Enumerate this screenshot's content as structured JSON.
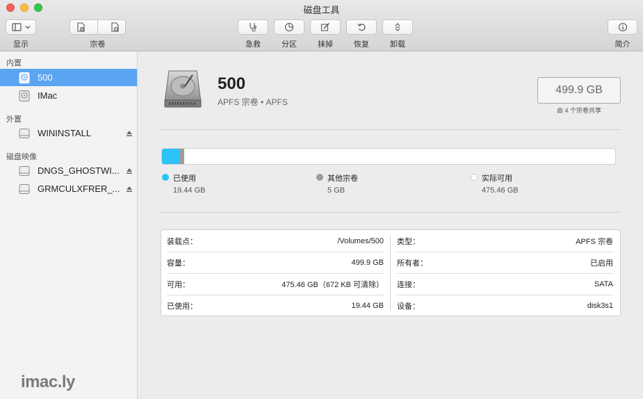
{
  "window": {
    "title": "磁盘工具"
  },
  "toolbar": {
    "display_label": "显示",
    "volume_label": "宗卷",
    "firstaid_label": "急救",
    "partition_label": "分区",
    "erase_label": "抹掉",
    "restore_label": "恢复",
    "unmount_label": "卸载",
    "info_label": "简介"
  },
  "sidebar": {
    "sections": [
      {
        "title": "内置",
        "items": [
          {
            "label": "500"
          },
          {
            "label": "IMac"
          }
        ]
      },
      {
        "title": "外置",
        "items": [
          {
            "label": "WININSTALL"
          }
        ]
      },
      {
        "title": "磁盘映像",
        "items": [
          {
            "label": "DNGS_GHOSTWI..."
          },
          {
            "label": "GRMCULXFRER_..."
          }
        ]
      }
    ],
    "watermark": "imac.ly"
  },
  "disk": {
    "name": "500",
    "subtitle": "APFS 宗卷 • APFS",
    "capacity": "499.9 GB",
    "capacity_note": "由 4 个宗卷共享"
  },
  "usage": {
    "total_gb": 499.9,
    "used_gb": 19.44,
    "other_gb": 5,
    "free_gb": 475.46,
    "used_color": "#2ec3f6",
    "other_color": "#9c9c9c",
    "free_color": "#ffffff",
    "legend": [
      {
        "label": "已使用",
        "value": "19.44 GB"
      },
      {
        "label": "其他宗卷",
        "value": "5 GB"
      },
      {
        "label": "实际可用",
        "value": "475.46 GB"
      }
    ]
  },
  "info": {
    "left": [
      {
        "key": "装载点：",
        "value": "/Volumes/500"
      },
      {
        "key": "容量：",
        "value": "499.9 GB"
      },
      {
        "key": "可用：",
        "value": "475.46 GB（672 KB 可清除）"
      },
      {
        "key": "已使用：",
        "value": "19.44 GB"
      }
    ],
    "right": [
      {
        "key": "类型：",
        "value": "APFS 宗卷"
      },
      {
        "key": "所有者：",
        "value": "已启用"
      },
      {
        "key": "连接：",
        "value": "SATA"
      },
      {
        "key": "设备：",
        "value": "disk3s1"
      }
    ]
  }
}
